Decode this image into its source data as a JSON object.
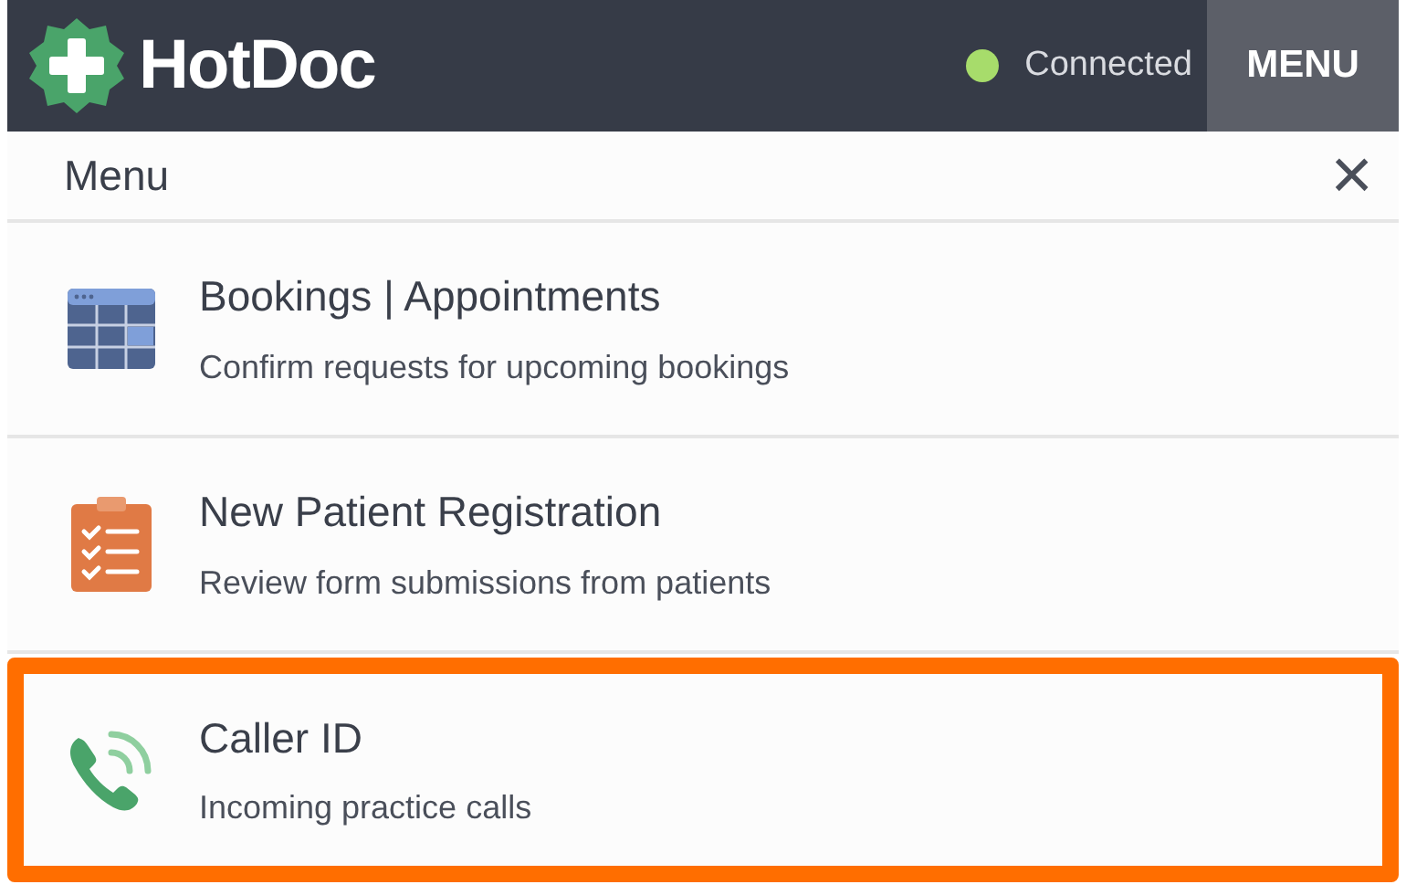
{
  "header": {
    "logo": "HotDoc",
    "status": {
      "label": "Connected",
      "connected": true
    },
    "menu_button": "MENU"
  },
  "panel": {
    "title": "Menu",
    "close": "×"
  },
  "items": [
    {
      "kind": "calendar",
      "title": "Bookings | Appointments",
      "subtitle": "Confirm requests for upcoming bookings",
      "highlighted": false
    },
    {
      "kind": "checklist",
      "title": "New Patient Registration",
      "subtitle": "Review form submissions from patients",
      "highlighted": false
    },
    {
      "kind": "phone",
      "title": "Caller ID",
      "subtitle": "Incoming practice calls",
      "highlighted": true
    }
  ]
}
